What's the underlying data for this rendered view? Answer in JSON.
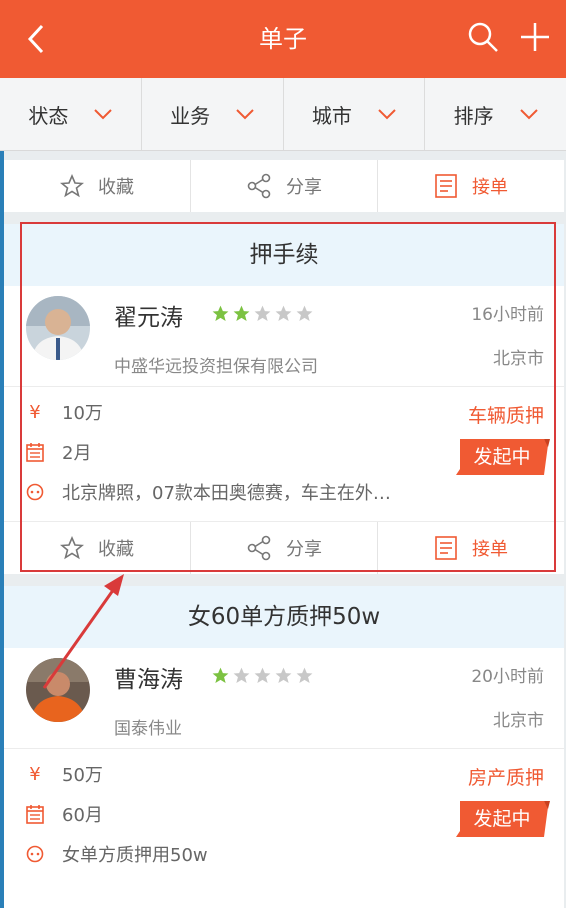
{
  "header": {
    "title": "单子",
    "back_icon": "back-arrow-icon",
    "search_icon": "search-icon",
    "add_icon": "plus-icon"
  },
  "filters": [
    {
      "label": "状态"
    },
    {
      "label": "业务"
    },
    {
      "label": "城市"
    },
    {
      "label": "排序"
    }
  ],
  "actions": {
    "favorite": "收藏",
    "share": "分享",
    "accept": "接单"
  },
  "cards": [
    {
      "title": "押手续",
      "name": "翟元涛",
      "rating": 2,
      "max_rating": 5,
      "time": "16小时前",
      "company": "中盛华远投资担保有限公司",
      "city": "北京市",
      "amount": "10万",
      "term": "2月",
      "desc": "北京牌照，07款本田奥德赛，车主在外…",
      "business_type": "车辆质押",
      "status": "发起中"
    },
    {
      "title": "女60单方质押50w",
      "name": "曹海涛",
      "rating": 1,
      "max_rating": 5,
      "time": "20小时前",
      "company": "国泰伟业",
      "city": "北京市",
      "amount": "50万",
      "term": "60月",
      "desc": "女单方质押用50w",
      "business_type": "房产质押",
      "status": "发起中"
    }
  ],
  "colors": {
    "primary": "#f05a33",
    "star_on": "#7cc242",
    "star_off": "#c8c8c8",
    "highlight_border": "#d93a3a",
    "card_head_bg": "#eaf5fc"
  }
}
